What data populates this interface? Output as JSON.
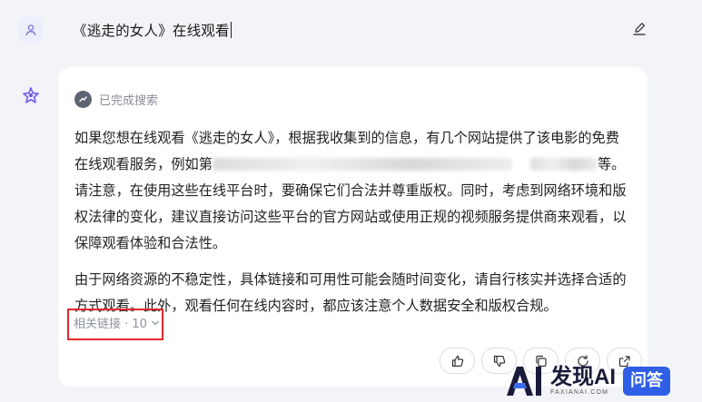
{
  "user": {
    "query": "《逃走的女人》在线观看"
  },
  "search_status": {
    "label": "已完成搜索"
  },
  "answer": {
    "p1_before": "如果您想在线观看《逃走的女人》，根据我收集到的信息，有几个网站提供了该电影的免费在线观看服务，例如第",
    "p1_after": "等。请注意，在使用这些在线平台时，要确保它们合法并尊重版权。同时，考虑到网络环境和版权法律的变化，建议直接访问这些平台的官方网站或使用正规的视频服务提供商来观看，以保障观看体验和合法性。",
    "p2": "由于网络资源的不稳定性，具体链接和可用性可能会随时间变化，请自行核实并选择合适的方式观看。此外，观看任何在线内容时，都应该注意个人数据安全和版权合规。"
  },
  "related_links": {
    "label": "相关链接 · 10"
  },
  "watermark": {
    "ai_mark": "AI",
    "brand": "发现AI",
    "sub": "FAXIANAI.COM",
    "badge": "问答"
  },
  "colors": {
    "highlight": "#e02a2a",
    "badge": "#2f5fe6"
  }
}
